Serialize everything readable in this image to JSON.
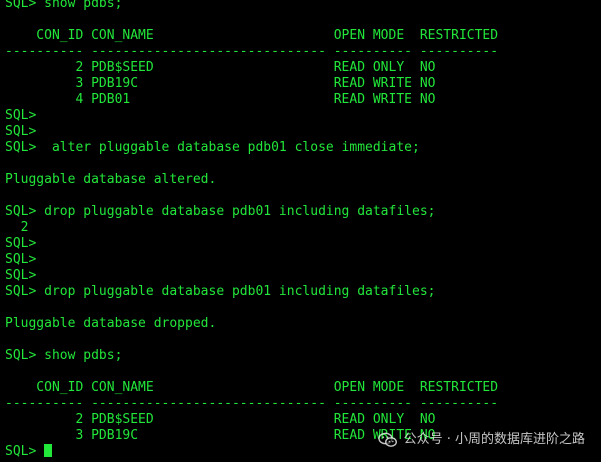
{
  "terminal": {
    "lines": [
      "SQL> show pdbs;",
      "",
      "    CON_ID CON_NAME                       OPEN MODE  RESTRICTED",
      "---------- ------------------------------ ---------- ----------",
      "         2 PDB$SEED                       READ ONLY  NO",
      "         3 PDB19C                         READ WRITE NO",
      "         4 PDB01                          READ WRITE NO",
      "SQL>",
      "SQL>",
      "SQL>  alter pluggable database pdb01 close immediate;",
      "",
      "Pluggable database altered.",
      "",
      "SQL> drop pluggable database pdb01 including datafiles;",
      "  2",
      "SQL>",
      "SQL>",
      "SQL>",
      "SQL> drop pluggable database pdb01 including datafiles;",
      "",
      "Pluggable database dropped.",
      "",
      "SQL> show pdbs;",
      "",
      "    CON_ID CON_NAME                       OPEN MODE  RESTRICTED",
      "---------- ------------------------------ ---------- ----------",
      "         2 PDB$SEED                       READ ONLY  NO",
      "         3 PDB19C                         READ WRITE NO"
    ],
    "prompt": "SQL> "
  },
  "watermark": {
    "text": "公众号 · 小周的数据库进阶之路",
    "icon": "wechat-icon"
  },
  "colors": {
    "background": "#000000",
    "text": "#22e63a"
  }
}
